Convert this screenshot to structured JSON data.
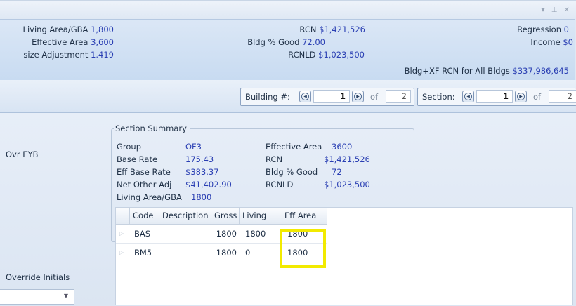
{
  "window": {
    "controls": "▾ ⊥ ✕"
  },
  "info": {
    "living_area_label": "Living Area/GBA",
    "living_area_value": "1,800",
    "effective_area_label": "Effective Area",
    "effective_area_value": "3,600",
    "size_adj_label": "size Adjustment",
    "size_adj_value": "1.419",
    "rcn_label": "RCN",
    "rcn_value": "$1,421,526",
    "bldg_good_label": "Bldg % Good",
    "bldg_good_value": "72.00",
    "rcnld_label": "RCNLD",
    "rcnld_value": "$1,023,500",
    "regression_label": "Regression",
    "regression_value": "0",
    "income_label": "Income",
    "income_value": "$0",
    "bldg_xf_label": "Bldg+XF RCN for All Bldgs",
    "bldg_xf_value": "$337,986,645"
  },
  "nav": {
    "building_label": "Building #:",
    "building_current": "1",
    "of_label": "of",
    "building_total": "2",
    "section_label": "Section:",
    "section_current": "1",
    "section_total": "2"
  },
  "left": {
    "ovr_eyb": "Ovr EYB",
    "override_initials": "Override Initials",
    "combo_value": ""
  },
  "summary": {
    "legend": "Section Summary",
    "group_label": "Group",
    "group_value": "OF3",
    "base_rate_label": "Base Rate",
    "base_rate_value": "175.43",
    "eff_base_rate_label": "Eff Base Rate",
    "eff_base_rate_value": "$383.37",
    "net_other_label": "Net Other Adj",
    "net_other_value": "$41,402.90",
    "living_gba_label": "Living Area/GBA",
    "living_gba_value": "1800",
    "eff_area_label": "Effective Area",
    "eff_area_value": "3600",
    "rcn_label": "RCN",
    "rcn_value": "$1,421,526",
    "bldg_good_label": "Bldg % Good",
    "bldg_good_value": "72",
    "rcnld_label": "RCNLD",
    "rcnld_value": "$1,023,500"
  },
  "grid": {
    "headers": [
      "Code",
      "Description",
      "Gross",
      "Living",
      "Eff Area"
    ],
    "rows": [
      {
        "code": "BAS",
        "description": "",
        "gross": "1800",
        "living": "1800",
        "eff_area": "1800"
      },
      {
        "code": "BM5",
        "description": "",
        "gross": "1800",
        "living": "0",
        "eff_area": "1800"
      }
    ]
  },
  "colors": {
    "value_text": "#2a3fb3",
    "highlight": "#f2ea00",
    "panel_bg": "#dfe8f4"
  }
}
